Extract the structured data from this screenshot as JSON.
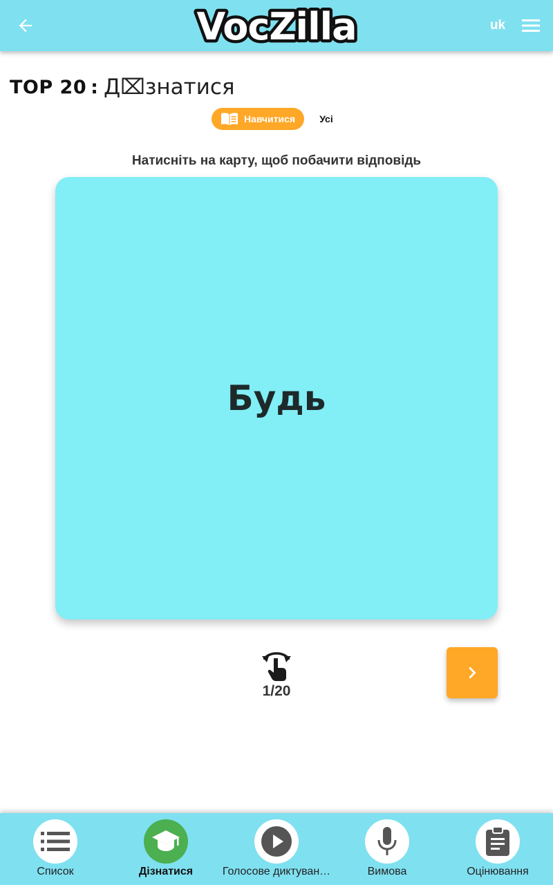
{
  "header": {
    "logo_text": "VocZilla",
    "language": "uk",
    "back_icon": "arrow-left-icon",
    "menu_icon": "hamburger-menu-icon"
  },
  "title": {
    "prefix": "TOP 20",
    "separator": ":",
    "word": "Д⌧знатися"
  },
  "mode_toggle": {
    "learn_label": "Навчитися",
    "learn_icon": "open-book-icon",
    "all_label": "Усі"
  },
  "instruction": "Натисніть на карту, щоб побачити відповідь",
  "card": {
    "word": "Будь"
  },
  "progress": {
    "flip_icon": "tap-rotate-icon",
    "counter": "1/20",
    "current": 1,
    "total": 20
  },
  "next_button": {
    "icon": "chevron-right-icon"
  },
  "bottom_nav": {
    "items": [
      {
        "label": "Список",
        "icon": "list-icon",
        "active": false
      },
      {
        "label": "Дізнатися",
        "icon": "graduation-cap-icon",
        "active": true
      },
      {
        "label": "Голосове диктуван…",
        "icon": "play-icon",
        "active": false
      },
      {
        "label": "Вимова",
        "icon": "microphone-icon",
        "active": false
      },
      {
        "label": "Оцінювання",
        "icon": "clipboard-icon",
        "active": false
      }
    ]
  },
  "colors": {
    "header_bg": "#7fe0f0",
    "card_bg": "#82eef6",
    "accent_orange": "#ffa726",
    "active_green": "#4caf50",
    "icon_gray": "#555555"
  }
}
